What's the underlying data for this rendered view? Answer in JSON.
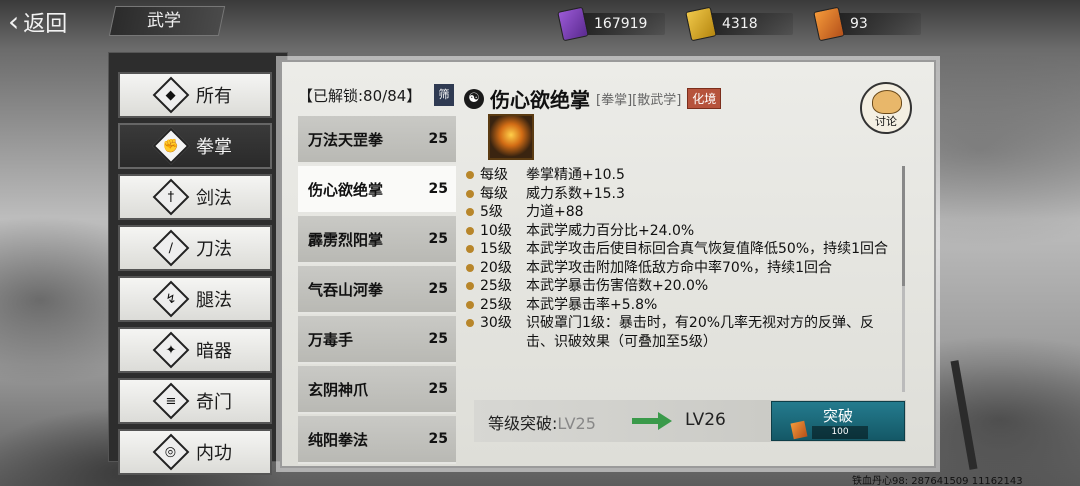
{
  "topbar": {
    "back_label": "返回",
    "section_title": "武学",
    "currencies": [
      {
        "icon": "purple-scroll-icon",
        "value": "167919"
      },
      {
        "icon": "gold-scroll-icon",
        "value": "4318"
      },
      {
        "icon": "orange-scroll-icon",
        "value": "93"
      }
    ]
  },
  "categories": [
    {
      "label": "所有",
      "icon": "all-icon",
      "glyph": "◆",
      "active": false
    },
    {
      "label": "拳掌",
      "icon": "fist-icon",
      "glyph": "✊",
      "active": true
    },
    {
      "label": "剑法",
      "icon": "sword-icon",
      "glyph": "†",
      "active": false
    },
    {
      "label": "刀法",
      "icon": "blade-icon",
      "glyph": "∕",
      "active": false
    },
    {
      "label": "腿法",
      "icon": "leg-icon",
      "glyph": "↯",
      "active": false
    },
    {
      "label": "暗器",
      "icon": "shuriken-icon",
      "glyph": "✦",
      "active": false
    },
    {
      "label": "奇门",
      "icon": "exotic-weapon-icon",
      "glyph": "≡",
      "active": false
    },
    {
      "label": "内功",
      "icon": "inner-force-icon",
      "glyph": "◎",
      "active": false
    }
  ],
  "list": {
    "unlock_text": "【已解锁:80/84】",
    "filter_label": "筛",
    "items": [
      {
        "name": "万法天罡拳",
        "level": "25",
        "active": false
      },
      {
        "name": "伤心欲绝掌",
        "level": "25",
        "active": true
      },
      {
        "name": "霹雳烈阳掌",
        "level": "25",
        "active": false
      },
      {
        "name": "气吞山河拳",
        "level": "25",
        "active": false
      },
      {
        "name": "万毒手",
        "level": "25",
        "active": false
      },
      {
        "name": "玄阴神爪",
        "level": "25",
        "active": false
      },
      {
        "name": "纯阳拳法",
        "level": "25",
        "active": false
      }
    ]
  },
  "detail": {
    "name": "伤心欲绝掌",
    "tags": "[拳掌][散武学]",
    "realm": "化境",
    "discuss_label": "讨论",
    "effects": [
      {
        "lv": "每级",
        "text": "拳掌精通+10.5"
      },
      {
        "lv": "每级",
        "text": "威力系数+15.3"
      },
      {
        "lv": "5级",
        "text": "力道+88"
      },
      {
        "lv": "10级",
        "text": "本武学威力百分比+24.0%"
      },
      {
        "lv": "15级",
        "text": "本武学攻击后使目标回合真气恢复值降低50%，持续1回合"
      },
      {
        "lv": "20级",
        "text": "本武学攻击附加降低敌方命中率70%，持续1回合"
      },
      {
        "lv": "25级",
        "text": "本武学暴击伤害倍数+20.0%"
      },
      {
        "lv": "25级",
        "text": "本武学暴击率+5.8%"
      },
      {
        "lv": "30级",
        "text": "识破罩门1级：暴击时，有20%几率无视对方的反弹、反击、识破效果（可叠加至5级）"
      }
    ]
  },
  "breakthrough": {
    "label": "等级突破:",
    "current": "LV25",
    "next": "LV26",
    "button_label": "突破",
    "cost": "100"
  },
  "footer": {
    "id_text": "铁血丹心98: 287641509  11162143"
  }
}
